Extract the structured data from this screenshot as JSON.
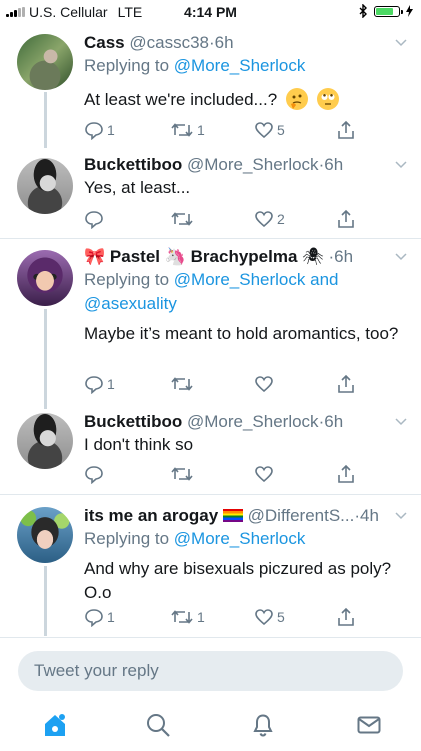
{
  "status_bar": {
    "carrier": "U.S. Cellular",
    "network": "LTE",
    "time": "4:14 PM",
    "battery_level": 0.7
  },
  "tweets": [
    {
      "name": "Cass",
      "handle": "@cassc38",
      "time": "6h",
      "reply_prefix": "Replying to",
      "reply_to": "@More_Sherlock",
      "text": "At least we're included...?",
      "emojis": [
        "thinking-face",
        "face-with-rolling-eyes"
      ],
      "replies": "1",
      "retweets": "1",
      "likes": "5"
    },
    {
      "name": "Buckettiboo",
      "handle": "@More_Sherlock",
      "time": "6h",
      "text": "Yes, at least...",
      "replies": "",
      "retweets": "",
      "likes": "2"
    },
    {
      "name_part1": "Pastel",
      "name_part2": "Brachypelma",
      "name_emojis": [
        "ribbon",
        "unicorn",
        "spider"
      ],
      "time": "6h",
      "reply_prefix": "Replying to",
      "reply_to": "@More_Sherlock",
      "reply_and": "and",
      "reply_to2": "@asexuality",
      "text": "Maybe it’s meant to hold aromantics, too?",
      "replies": "1",
      "retweets": "",
      "likes": ""
    },
    {
      "name": "Buckettiboo",
      "handle": "@More_Sherlock",
      "time": "6h",
      "text": "I don't think so",
      "replies": "",
      "retweets": "",
      "likes": ""
    },
    {
      "name": "its me an arogay",
      "name_emoji": "rainbow-flag",
      "handle": "@DifferentS...",
      "time": "4h",
      "reply_prefix": "Replying to",
      "reply_to": "@More_Sherlock",
      "text": "And why are bisexuals piczured as poly? O.o",
      "replies": "1",
      "retweets": "1",
      "likes": "5"
    }
  ],
  "compose": {
    "placeholder": "Tweet your reply"
  },
  "tabs": [
    "home-icon",
    "search-icon",
    "notifications-icon",
    "messages-icon"
  ],
  "colors": {
    "accent": "#1da1f2",
    "link": "#1b95e0",
    "muted": "#657786",
    "thread_line": "#ccd6dd"
  }
}
